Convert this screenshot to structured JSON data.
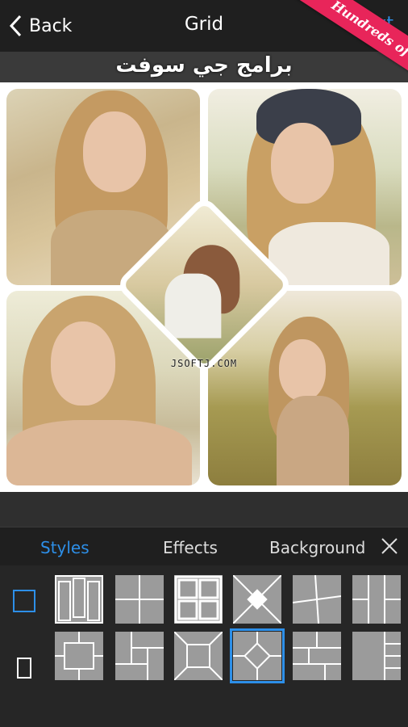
{
  "header": {
    "back_label": "Back",
    "title": "Grid",
    "next_label": "Next",
    "ribbon_text": "Hundreds of Layouts"
  },
  "overlay": {
    "arabic_watermark": "برامج جي سوفت",
    "site_watermark": "JSOFTJ.COM"
  },
  "tabs": [
    {
      "label": "Styles",
      "active": true
    },
    {
      "label": "Effects",
      "active": false
    },
    {
      "label": "Background",
      "active": false
    }
  ],
  "layouts": {
    "rows": 2,
    "per_row": 6,
    "selected_row": 2,
    "selected_index": 4
  },
  "colors": {
    "accent": "#2d8fe8",
    "ribbon": "#e8255a"
  }
}
